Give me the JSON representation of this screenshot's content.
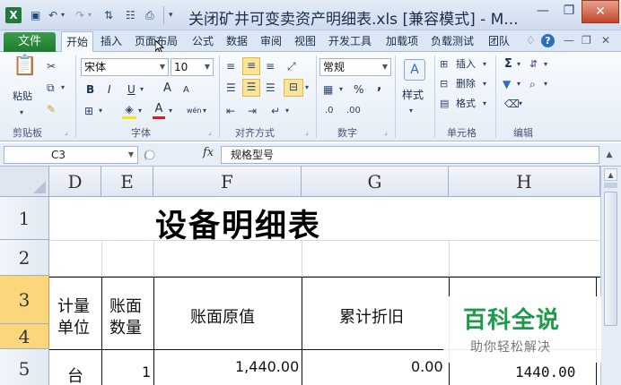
{
  "window": {
    "title": "关闭矿井可变卖资产明细表.xls  [兼容模式] - M...",
    "app_icon": "excel-logo-icon",
    "minimize_glyph": "—",
    "restore_glyph": "❐",
    "close_glyph": "✕"
  },
  "ribbon_tabs": {
    "file": "文件",
    "tabs": [
      "开始",
      "插入",
      "页面布局",
      "公式",
      "数据",
      "审阅",
      "视图",
      "开发工具",
      "加载项",
      "负载测试",
      "团队"
    ],
    "active": "开始",
    "right_glyphs": [
      "♢",
      "—",
      "❐",
      "✕"
    ]
  },
  "ribbon": {
    "clipboard": {
      "paste": "粘贴",
      "label": "剪贴板"
    },
    "font": {
      "name": "宋体",
      "size": "10",
      "label": "字体",
      "bold": "B",
      "italic": "I",
      "underline": "U",
      "grow": "A",
      "shrink": "A",
      "font_color": "A",
      "phonetic": "wén"
    },
    "alignment": {
      "label": "对齐方式"
    },
    "number": {
      "format": "常规",
      "label": "数字",
      "percent": "%",
      "comma": ","
    },
    "styles": {
      "label": "样式",
      "style_letter": "A"
    },
    "cells": {
      "insert": "插入",
      "delete": "删除",
      "format": "格式",
      "label": "单元格"
    },
    "editing": {
      "label": "编辑",
      "sum": "Σ"
    }
  },
  "formula_bar": {
    "name_box": "C3",
    "fx": "fx",
    "content": "规格型号"
  },
  "sheet": {
    "columns": [
      "D",
      "E",
      "F",
      "G",
      "H"
    ],
    "rows": [
      "1",
      "2",
      "3",
      "4",
      "5"
    ],
    "title": "设备明细表",
    "headers": {
      "unit_line1": "计量",
      "unit_line2": "单位",
      "qty_line1": "账面",
      "qty_line2": "数量",
      "book_value": "账面原值",
      "depreciation": "累计折旧"
    },
    "row5": {
      "unit": "台",
      "qty": "1",
      "book_value": "1,440.00",
      "depreciation": "0.00",
      "h": "1440.00"
    }
  },
  "watermark": {
    "title": "百科全说",
    "subtitle": "助你轻松解决"
  }
}
